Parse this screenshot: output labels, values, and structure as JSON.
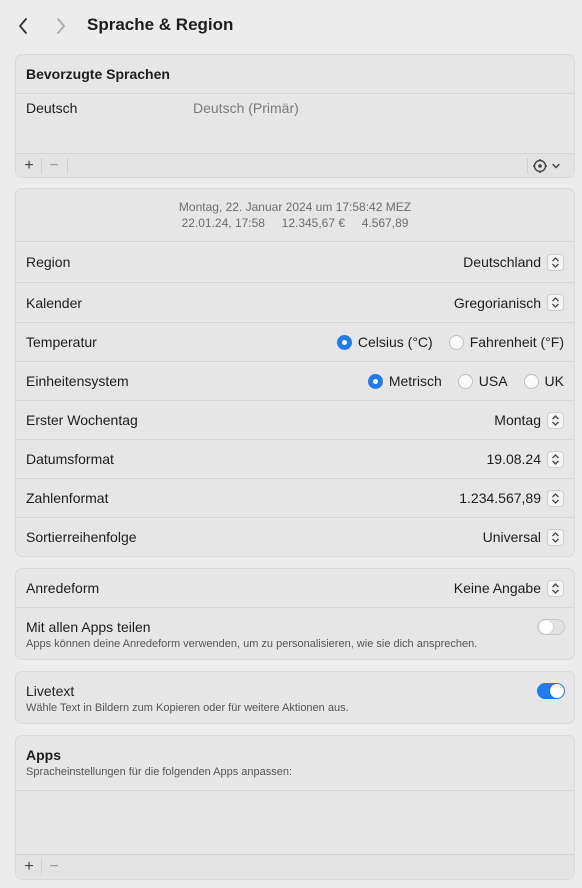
{
  "header": {
    "title": "Sprache & Region"
  },
  "languages": {
    "heading": "Bevorzugte Sprachen",
    "items": [
      {
        "name": "Deutsch",
        "detail": "Deutsch (Primär)"
      }
    ],
    "add": "+",
    "remove": "−"
  },
  "preview": {
    "line1": "Montag, 22. Januar 2024 um 17:58:42 MEZ",
    "line2": "22.01.24, 17:58     12.345,67 €     4.567,89"
  },
  "settings": {
    "region": {
      "label": "Region",
      "value": "Deutschland"
    },
    "calendar": {
      "label": "Kalender",
      "value": "Gregorianisch"
    },
    "temperature": {
      "label": "Temperatur",
      "options": [
        "Celsius (°C)",
        "Fahrenheit (°F)"
      ],
      "selected": "Celsius (°C)"
    },
    "units": {
      "label": "Einheitensystem",
      "options": [
        "Metrisch",
        "USA",
        "UK"
      ],
      "selected": "Metrisch"
    },
    "first_weekday": {
      "label": "Erster Wochentag",
      "value": "Montag"
    },
    "date_format": {
      "label": "Datumsformat",
      "value": "19.08.24"
    },
    "number_format": {
      "label": "Zahlenformat",
      "value": "1.234.567,89"
    },
    "sort_order": {
      "label": "Sortierreihenfolge",
      "value": "Universal"
    }
  },
  "address": {
    "label": "Anredeform",
    "value": "Keine Angabe",
    "share_label": "Mit allen Apps teilen",
    "share_desc": "Apps können deine Anredeform verwenden, um zu personalisieren, wie sie dich ansprechen.",
    "share_on": false
  },
  "livetext": {
    "label": "Livetext",
    "desc": "Wähle Text in Bildern zum Kopieren oder für weitere Aktionen aus.",
    "on": true
  },
  "apps": {
    "heading": "Apps",
    "desc": "Spracheinstellungen für die folgenden Apps anpassen:",
    "add": "+",
    "remove": "−"
  },
  "colors": {
    "accent": "#1f7cf0",
    "panel": "#e6e6e6",
    "background": "#ececec"
  }
}
